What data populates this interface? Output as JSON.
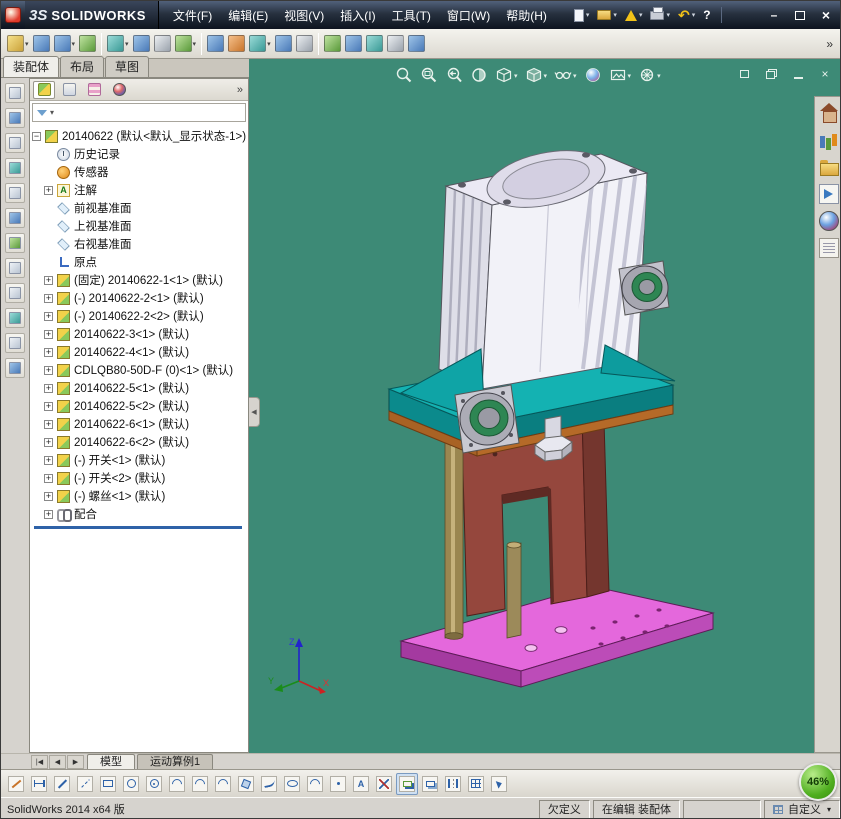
{
  "titlebar": {
    "logo_mark": "3S",
    "logo_text": "SOLIDWORKS",
    "menus": [
      "文件(F)",
      "编辑(E)",
      "视图(V)",
      "插入(I)",
      "工具(T)",
      "窗口(W)",
      "帮助(H)"
    ]
  },
  "qat_icons": [
    "new-document",
    "open-document",
    "save-alert",
    "print",
    "undo",
    "help"
  ],
  "top_toolbar_icons": [
    "insert-components",
    "mate",
    "linear-component-pattern",
    "smart-fasteners",
    "move-component",
    "rotate-component",
    "show-hidden-components",
    "assembly-features",
    "reference-geometry",
    "new-motion-study",
    "bill-of-materials",
    "exploded-view",
    "explode-line-sketch",
    "interference-detection",
    "measure",
    "mass-properties",
    "section-view",
    "options"
  ],
  "left_toolbar_icons": [
    "front-view",
    "back-view",
    "left-view",
    "right-view",
    "top-view",
    "bottom-view",
    "isometric-view",
    "normal-to-view",
    "wireframe-display",
    "hidden-lines-visible",
    "hidden-lines-removed",
    "shaded-with-edges"
  ],
  "panel": {
    "tabs": [
      "装配体",
      "布局",
      "草图"
    ],
    "manager_tabs": [
      "featuremanager-design-tree",
      "propertymanager",
      "configurationmanager",
      "displaymanager"
    ]
  },
  "tree": {
    "root": {
      "icon": "assembly-icon",
      "label": "20140622 (默认<默认_显示状态-1>)"
    },
    "items": [
      {
        "icon": "history-folder-icon",
        "label": "历史记录"
      },
      {
        "icon": "sensors-icon",
        "label": "传感器"
      },
      {
        "icon": "annotations-icon",
        "label": "注解"
      },
      {
        "icon": "plane-icon",
        "label": "前视基准面"
      },
      {
        "icon": "plane-icon",
        "label": "上视基准面"
      },
      {
        "icon": "plane-icon",
        "label": "右视基准面"
      },
      {
        "icon": "origin-icon",
        "label": "原点"
      },
      {
        "icon": "component-icon",
        "label": "(固定) 20140622-1<1> (默认)"
      },
      {
        "icon": "component-icon",
        "label": "(-) 20140622-2<1> (默认)"
      },
      {
        "icon": "component-icon",
        "label": "(-) 20140622-2<2> (默认)"
      },
      {
        "icon": "component-icon",
        "label": "20140622-3<1> (默认)"
      },
      {
        "icon": "component-icon",
        "label": "20140622-4<1> (默认)"
      },
      {
        "icon": "component-icon",
        "label": "CDLQB80-50D-F (0)<1> (默认)"
      },
      {
        "icon": "component-icon",
        "label": "20140622-5<1> (默认)"
      },
      {
        "icon": "component-icon",
        "label": "20140622-5<2> (默认)"
      },
      {
        "icon": "component-icon",
        "label": "20140622-6<1> (默认)"
      },
      {
        "icon": "component-icon",
        "label": "20140622-6<2> (默认)"
      },
      {
        "icon": "component-icon",
        "label": "(-) 开关<1> (默认)"
      },
      {
        "icon": "component-icon",
        "label": "(-) 开关<2> (默认)"
      },
      {
        "icon": "component-icon",
        "label": "(-) 螺丝<1> (默认)"
      },
      {
        "icon": "mates-icon",
        "label": "配合"
      }
    ]
  },
  "hud_icons": [
    "zoom-to-fit",
    "zoom-to-area",
    "previous-view",
    "section-view",
    "view-orientation",
    "display-style",
    "hide-show-items",
    "edit-appearance",
    "apply-scene",
    "view-settings"
  ],
  "viewport_controls": [
    "restore-window",
    "tile-window",
    "minimize-window",
    "close-window"
  ],
  "task_pane_icons": [
    "solidworks-resources",
    "design-library",
    "file-explorer",
    "view-palette",
    "appearances",
    "custom-properties"
  ],
  "triad": {
    "x": "X",
    "y": "Y",
    "z": "Z"
  },
  "bottom_tabs": {
    "nav": [
      "first",
      "previous",
      "next"
    ],
    "tabs": [
      "模型",
      "运动算例1"
    ],
    "active": "模型"
  },
  "bottom_toolbar_icons": [
    "sketch",
    "smart-dimension",
    "line",
    "centerline",
    "corner-rectangle",
    "circle",
    "perimeter-circle",
    "centerpoint-arc",
    "tangent-arc",
    "three-point-arc",
    "polygon",
    "spline",
    "ellipse",
    "sketch-fillet",
    "point",
    "text",
    "trim-entities",
    "convert-entities",
    "offset-entities",
    "mirror-entities",
    "linear-sketch-pattern",
    "move-entities"
  ],
  "statusbar": {
    "app_version": "SolidWorks 2014 x64 版",
    "define_state": "欠定义",
    "edit_state": "在编辑 装配体",
    "custom_label": "自定义",
    "battery_percent": "46%"
  },
  "glyphs": {
    "plus": "+",
    "minus": "−",
    "caret": "▾",
    "chevrons": "»",
    "left_arrow": "◀",
    "right_arrow": "▶",
    "tab_first": "|◀",
    "minimize": "–",
    "close": "×",
    "help": "?",
    "undo": "↶"
  },
  "colors": {
    "viewport_bg": "#3d8a76",
    "base_plate": "#e468dc",
    "bracket": "#14b2b2",
    "column": "#95473d",
    "cylinder": "#f2f2f8",
    "battery_green": "#4fae1f"
  }
}
